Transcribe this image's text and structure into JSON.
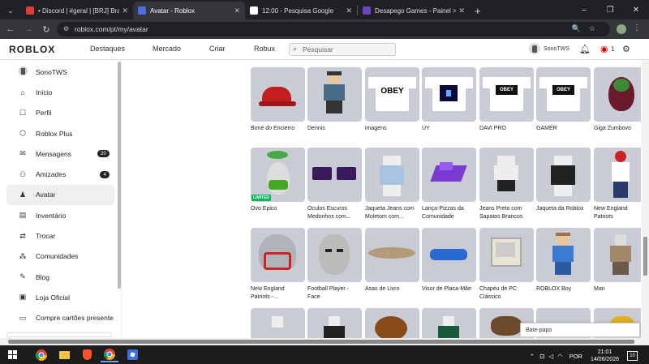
{
  "browser": {
    "tabs": [
      {
        "title": "• Discord | #geral | [BRJ] Brasil",
        "fav_color": "#e03b3b"
      },
      {
        "title": "Avatar - Roblox",
        "fav_color": "#4a6ee0"
      },
      {
        "title": "12:00 - Pesquisa Google",
        "fav_color": "#ffffff"
      },
      {
        "title": "Desapego Games - Painel > Am",
        "fav_color": "#6b46c1"
      }
    ],
    "url": "roblox.com/pt/my/avatar"
  },
  "header": {
    "logo": "ROBLOX",
    "nav": [
      "Destaques",
      "Mercado",
      "Criar",
      "Robux"
    ],
    "search_placeholder": "Pesquisar",
    "username": "SonoTWS",
    "robux_count": "1"
  },
  "sidebar": {
    "items": [
      {
        "label": "SonoTWS",
        "icon": "avatar-icon"
      },
      {
        "label": "Início",
        "icon": "home-icon",
        "glyph": "⌂"
      },
      {
        "label": "Perfil",
        "icon": "profile-icon",
        "glyph": "☐"
      },
      {
        "label": "Roblox Plus",
        "icon": "plus-icon",
        "glyph": "⬡"
      },
      {
        "label": "Mensagens",
        "icon": "messages-icon",
        "glyph": "✉",
        "badge": "20"
      },
      {
        "label": "Amizades",
        "icon": "friends-icon",
        "glyph": "⚇",
        "badge": "4"
      },
      {
        "label": "Avatar",
        "icon": "avatar-figure-icon",
        "glyph": "♟"
      },
      {
        "label": "Inventário",
        "icon": "inventory-icon",
        "glyph": "▤"
      },
      {
        "label": "Trocar",
        "icon": "trade-icon",
        "glyph": "⇄"
      },
      {
        "label": "Comunidades",
        "icon": "groups-icon",
        "glyph": "⁂"
      },
      {
        "label": "Blog",
        "icon": "blog-icon",
        "glyph": "✎"
      },
      {
        "label": "Loja Oficial",
        "icon": "store-icon",
        "glyph": "▣"
      },
      {
        "label": "Compre cartões presente",
        "icon": "gift-card-icon",
        "glyph": "▭"
      }
    ]
  },
  "items": [
    {
      "name": "Boné do Encierro",
      "art": "cap"
    },
    {
      "name": "Dennis",
      "art": "char"
    },
    {
      "name": "imagens",
      "art": "obey"
    },
    {
      "name": "UY",
      "art": "darkshirt"
    },
    {
      "name": "DAVI PRO",
      "art": "obey2"
    },
    {
      "name": "GAMER",
      "art": "obey2"
    },
    {
      "name": "Giga Zumbovo",
      "art": "egg"
    },
    {
      "name": "Ovo Épico",
      "art": "epicegg",
      "limited": "LIMITED"
    },
    {
      "name": "Óculos Escuros Medonhos com...",
      "art": "glasses"
    },
    {
      "name": "Jaqueta Jeans com Moletom com...",
      "art": "jeans"
    },
    {
      "name": "Lança-Pizzas da Comunidade",
      "art": "pizza"
    },
    {
      "name": "Jeans Preto com Sapatos Brancos",
      "art": "blackpants"
    },
    {
      "name": "Jaqueta da Roblox",
      "art": "jacket"
    },
    {
      "name": "New England Patriots",
      "art": "patriot"
    },
    {
      "name": "New England Patriots -...",
      "art": "helmet"
    },
    {
      "name": "Football Player - Face",
      "art": "face"
    },
    {
      "name": "Asas de Livro",
      "art": "wings"
    },
    {
      "name": "Visor de Placa-Mãe",
      "art": "visor"
    },
    {
      "name": "Chapéu de PC Clássico",
      "art": "pc"
    },
    {
      "name": "ROBLOX Boy",
      "art": "boy"
    },
    {
      "name": "Man",
      "art": "man"
    },
    {
      "name": "",
      "art": "white"
    },
    {
      "name": "",
      "art": "suit"
    },
    {
      "name": "",
      "art": "hair"
    },
    {
      "name": "",
      "art": "green"
    },
    {
      "name": "",
      "art": "brown"
    },
    {
      "name": "",
      "art": "blank"
    },
    {
      "name": "",
      "art": "yellow"
    }
  ],
  "chat": {
    "label": "Bate-papo"
  },
  "taskbar": {
    "lang": "POR",
    "time": "21:01",
    "date": "14/06/2026",
    "notif": "10"
  }
}
